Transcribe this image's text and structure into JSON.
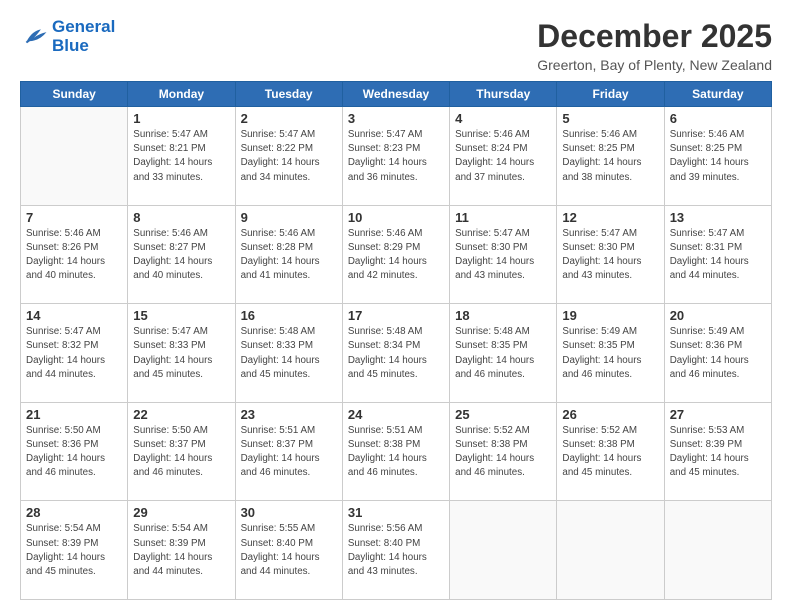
{
  "logo": {
    "line1": "General",
    "line2": "Blue"
  },
  "header": {
    "month": "December 2025",
    "location": "Greerton, Bay of Plenty, New Zealand"
  },
  "weekdays": [
    "Sunday",
    "Monday",
    "Tuesday",
    "Wednesday",
    "Thursday",
    "Friday",
    "Saturday"
  ],
  "weeks": [
    [
      {
        "day": "",
        "sunrise": "",
        "sunset": "",
        "daylight": ""
      },
      {
        "day": "1",
        "sunrise": "Sunrise: 5:47 AM",
        "sunset": "Sunset: 8:21 PM",
        "daylight": "Daylight: 14 hours and 33 minutes."
      },
      {
        "day": "2",
        "sunrise": "Sunrise: 5:47 AM",
        "sunset": "Sunset: 8:22 PM",
        "daylight": "Daylight: 14 hours and 34 minutes."
      },
      {
        "day": "3",
        "sunrise": "Sunrise: 5:47 AM",
        "sunset": "Sunset: 8:23 PM",
        "daylight": "Daylight: 14 hours and 36 minutes."
      },
      {
        "day": "4",
        "sunrise": "Sunrise: 5:46 AM",
        "sunset": "Sunset: 8:24 PM",
        "daylight": "Daylight: 14 hours and 37 minutes."
      },
      {
        "day": "5",
        "sunrise": "Sunrise: 5:46 AM",
        "sunset": "Sunset: 8:25 PM",
        "daylight": "Daylight: 14 hours and 38 minutes."
      },
      {
        "day": "6",
        "sunrise": "Sunrise: 5:46 AM",
        "sunset": "Sunset: 8:25 PM",
        "daylight": "Daylight: 14 hours and 39 minutes."
      }
    ],
    [
      {
        "day": "7",
        "sunrise": "Sunrise: 5:46 AM",
        "sunset": "Sunset: 8:26 PM",
        "daylight": "Daylight: 14 hours and 40 minutes."
      },
      {
        "day": "8",
        "sunrise": "Sunrise: 5:46 AM",
        "sunset": "Sunset: 8:27 PM",
        "daylight": "Daylight: 14 hours and 40 minutes."
      },
      {
        "day": "9",
        "sunrise": "Sunrise: 5:46 AM",
        "sunset": "Sunset: 8:28 PM",
        "daylight": "Daylight: 14 hours and 41 minutes."
      },
      {
        "day": "10",
        "sunrise": "Sunrise: 5:46 AM",
        "sunset": "Sunset: 8:29 PM",
        "daylight": "Daylight: 14 hours and 42 minutes."
      },
      {
        "day": "11",
        "sunrise": "Sunrise: 5:47 AM",
        "sunset": "Sunset: 8:30 PM",
        "daylight": "Daylight: 14 hours and 43 minutes."
      },
      {
        "day": "12",
        "sunrise": "Sunrise: 5:47 AM",
        "sunset": "Sunset: 8:30 PM",
        "daylight": "Daylight: 14 hours and 43 minutes."
      },
      {
        "day": "13",
        "sunrise": "Sunrise: 5:47 AM",
        "sunset": "Sunset: 8:31 PM",
        "daylight": "Daylight: 14 hours and 44 minutes."
      }
    ],
    [
      {
        "day": "14",
        "sunrise": "Sunrise: 5:47 AM",
        "sunset": "Sunset: 8:32 PM",
        "daylight": "Daylight: 14 hours and 44 minutes."
      },
      {
        "day": "15",
        "sunrise": "Sunrise: 5:47 AM",
        "sunset": "Sunset: 8:33 PM",
        "daylight": "Daylight: 14 hours and 45 minutes."
      },
      {
        "day": "16",
        "sunrise": "Sunrise: 5:48 AM",
        "sunset": "Sunset: 8:33 PM",
        "daylight": "Daylight: 14 hours and 45 minutes."
      },
      {
        "day": "17",
        "sunrise": "Sunrise: 5:48 AM",
        "sunset": "Sunset: 8:34 PM",
        "daylight": "Daylight: 14 hours and 45 minutes."
      },
      {
        "day": "18",
        "sunrise": "Sunrise: 5:48 AM",
        "sunset": "Sunset: 8:35 PM",
        "daylight": "Daylight: 14 hours and 46 minutes."
      },
      {
        "day": "19",
        "sunrise": "Sunrise: 5:49 AM",
        "sunset": "Sunset: 8:35 PM",
        "daylight": "Daylight: 14 hours and 46 minutes."
      },
      {
        "day": "20",
        "sunrise": "Sunrise: 5:49 AM",
        "sunset": "Sunset: 8:36 PM",
        "daylight": "Daylight: 14 hours and 46 minutes."
      }
    ],
    [
      {
        "day": "21",
        "sunrise": "Sunrise: 5:50 AM",
        "sunset": "Sunset: 8:36 PM",
        "daylight": "Daylight: 14 hours and 46 minutes."
      },
      {
        "day": "22",
        "sunrise": "Sunrise: 5:50 AM",
        "sunset": "Sunset: 8:37 PM",
        "daylight": "Daylight: 14 hours and 46 minutes."
      },
      {
        "day": "23",
        "sunrise": "Sunrise: 5:51 AM",
        "sunset": "Sunset: 8:37 PM",
        "daylight": "Daylight: 14 hours and 46 minutes."
      },
      {
        "day": "24",
        "sunrise": "Sunrise: 5:51 AM",
        "sunset": "Sunset: 8:38 PM",
        "daylight": "Daylight: 14 hours and 46 minutes."
      },
      {
        "day": "25",
        "sunrise": "Sunrise: 5:52 AM",
        "sunset": "Sunset: 8:38 PM",
        "daylight": "Daylight: 14 hours and 46 minutes."
      },
      {
        "day": "26",
        "sunrise": "Sunrise: 5:52 AM",
        "sunset": "Sunset: 8:38 PM",
        "daylight": "Daylight: 14 hours and 45 minutes."
      },
      {
        "day": "27",
        "sunrise": "Sunrise: 5:53 AM",
        "sunset": "Sunset: 8:39 PM",
        "daylight": "Daylight: 14 hours and 45 minutes."
      }
    ],
    [
      {
        "day": "28",
        "sunrise": "Sunrise: 5:54 AM",
        "sunset": "Sunset: 8:39 PM",
        "daylight": "Daylight: 14 hours and 45 minutes."
      },
      {
        "day": "29",
        "sunrise": "Sunrise: 5:54 AM",
        "sunset": "Sunset: 8:39 PM",
        "daylight": "Daylight: 14 hours and 44 minutes."
      },
      {
        "day": "30",
        "sunrise": "Sunrise: 5:55 AM",
        "sunset": "Sunset: 8:40 PM",
        "daylight": "Daylight: 14 hours and 44 minutes."
      },
      {
        "day": "31",
        "sunrise": "Sunrise: 5:56 AM",
        "sunset": "Sunset: 8:40 PM",
        "daylight": "Daylight: 14 hours and 43 minutes."
      },
      {
        "day": "",
        "sunrise": "",
        "sunset": "",
        "daylight": ""
      },
      {
        "day": "",
        "sunrise": "",
        "sunset": "",
        "daylight": ""
      },
      {
        "day": "",
        "sunrise": "",
        "sunset": "",
        "daylight": ""
      }
    ]
  ]
}
